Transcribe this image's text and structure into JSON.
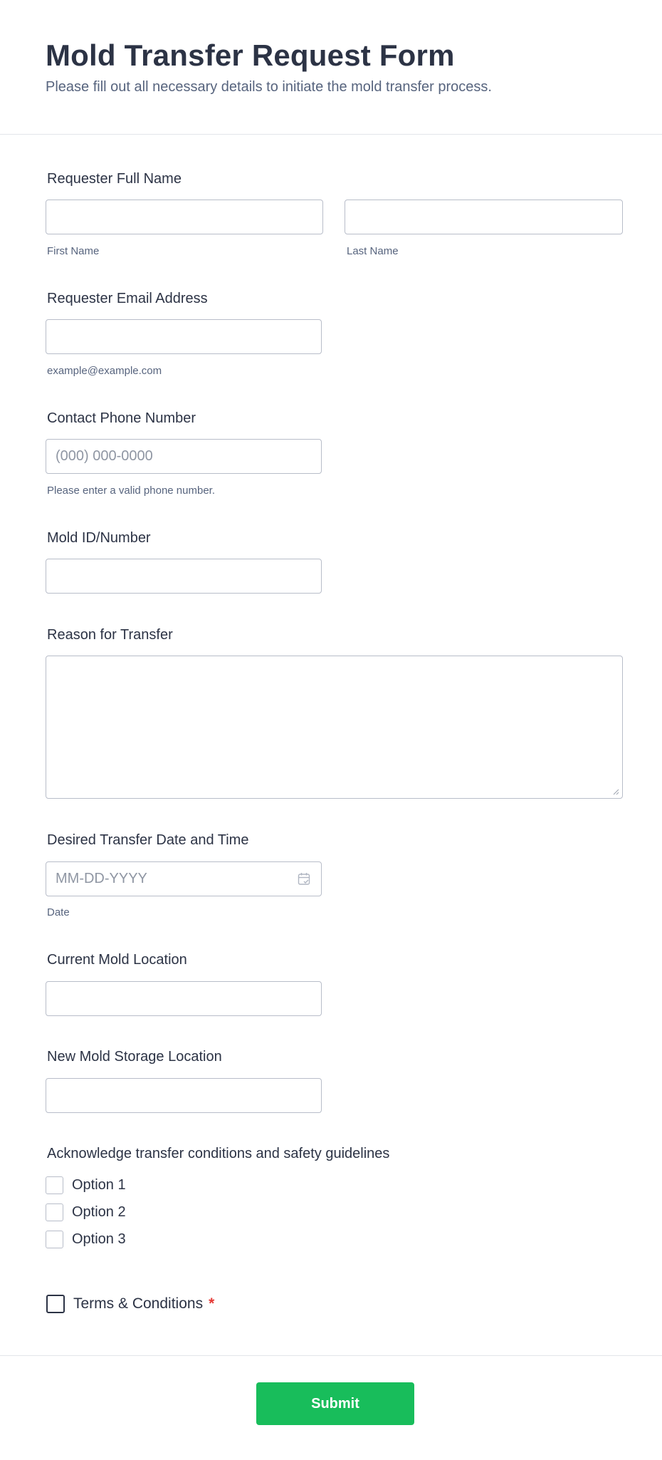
{
  "header": {
    "title": "Mold Transfer Request Form",
    "subtitle": "Please fill out all necessary details to initiate the mold transfer process."
  },
  "fields": {
    "full_name": {
      "label": "Requester Full Name",
      "first_sublabel": "First Name",
      "last_sublabel": "Last Name",
      "first_value": "",
      "last_value": ""
    },
    "email": {
      "label": "Requester Email Address",
      "value": "",
      "sublabel": "example@example.com"
    },
    "phone": {
      "label": "Contact Phone Number",
      "placeholder": "(000) 000-0000",
      "sublabel": "Please enter a valid phone number."
    },
    "mold_id": {
      "label": "Mold ID/Number",
      "value": ""
    },
    "reason": {
      "label": "Reason for Transfer",
      "value": ""
    },
    "transfer_date": {
      "label": "Desired Transfer Date and Time",
      "placeholder": "MM-DD-YYYY",
      "sublabel": "Date",
      "icon": "calendar-icon"
    },
    "current_location": {
      "label": "Current Mold Location",
      "value": ""
    },
    "new_location": {
      "label": "New Mold Storage Location",
      "value": ""
    },
    "acknowledge": {
      "label": "Acknowledge transfer conditions and safety guidelines",
      "options": [
        {
          "label": "Option 1",
          "checked": false
        },
        {
          "label": "Option 2",
          "checked": false
        },
        {
          "label": "Option 3",
          "checked": false
        }
      ]
    },
    "terms": {
      "label": "Terms & Conditions",
      "required_mark": "*",
      "checked": false
    }
  },
  "submit": {
    "label": "Submit",
    "color": "#18bd5b"
  },
  "colors": {
    "text": "#2c3345",
    "sublabel": "#57647e",
    "border": "#b8bdc9",
    "required": "#e53935"
  }
}
